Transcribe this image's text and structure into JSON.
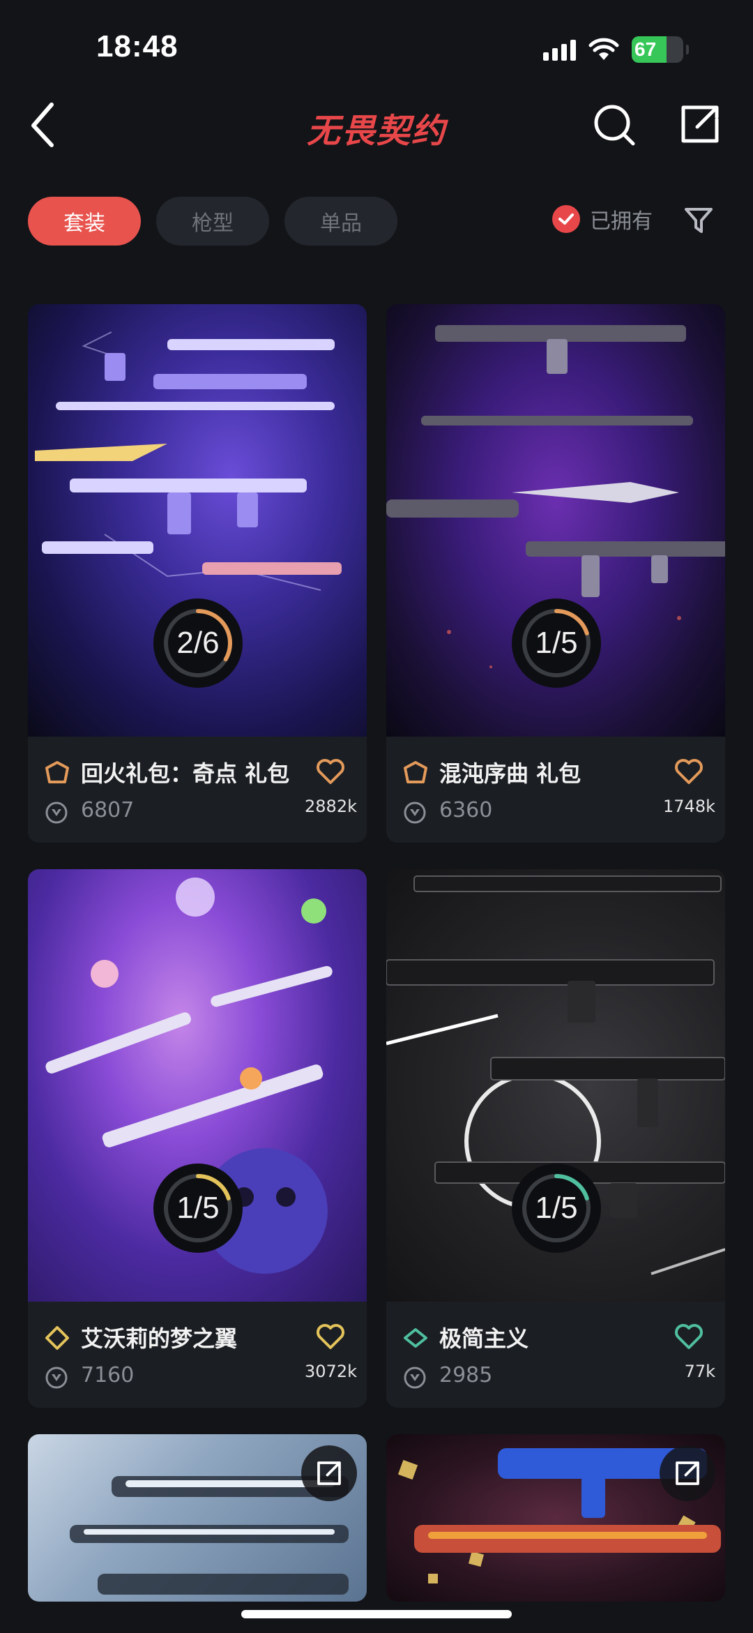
{
  "status": {
    "time": "18:48",
    "battery": "67",
    "battery_level": 0.67
  },
  "header": {
    "title": "无畏契约",
    "back_icon": "chevron-left-icon",
    "search_icon": "search-icon",
    "share_icon": "share-icon"
  },
  "filters": {
    "tabs": [
      "套装",
      "枪型",
      "单品"
    ],
    "active_tab": 0,
    "owned_label": "已拥有",
    "filter_icon": "filter-icon"
  },
  "colors": {
    "accent": "#e8474a",
    "tier_orange": "#e39a5a",
    "tier_gold": "#e3c35a",
    "tier_green": "#4fbfa0",
    "ring_track": "#3a3d42"
  },
  "cards": [
    {
      "name": "回火礼包：奇点 礼包",
      "price": "6807",
      "likes": "2882k",
      "progress": "2/6",
      "owned": 2,
      "total": 6,
      "tier_color": "#e39a5a",
      "ring_color": "#e39a5a",
      "heart_color": "#e39a5a"
    },
    {
      "name": "混沌序曲 礼包",
      "price": "6360",
      "likes": "1748k",
      "progress": "1/5",
      "owned": 1,
      "total": 5,
      "tier_color": "#e39a5a",
      "ring_color": "#e39a5a",
      "heart_color": "#e39a5a"
    },
    {
      "name": "艾沃莉的梦之翼",
      "price": "7160",
      "likes": "3072k",
      "progress": "1/5",
      "owned": 1,
      "total": 5,
      "tier_color": "#e3c35a",
      "ring_color": "#e3c35a",
      "heart_color": "#e3c35a"
    },
    {
      "name": "极简主义",
      "price": "2985",
      "likes": "77k",
      "progress": "1/5",
      "owned": 1,
      "total": 5,
      "tier_color": "#4fbfa0",
      "ring_color": "#4fbfa0",
      "heart_color": "#4fbfa0"
    }
  ]
}
